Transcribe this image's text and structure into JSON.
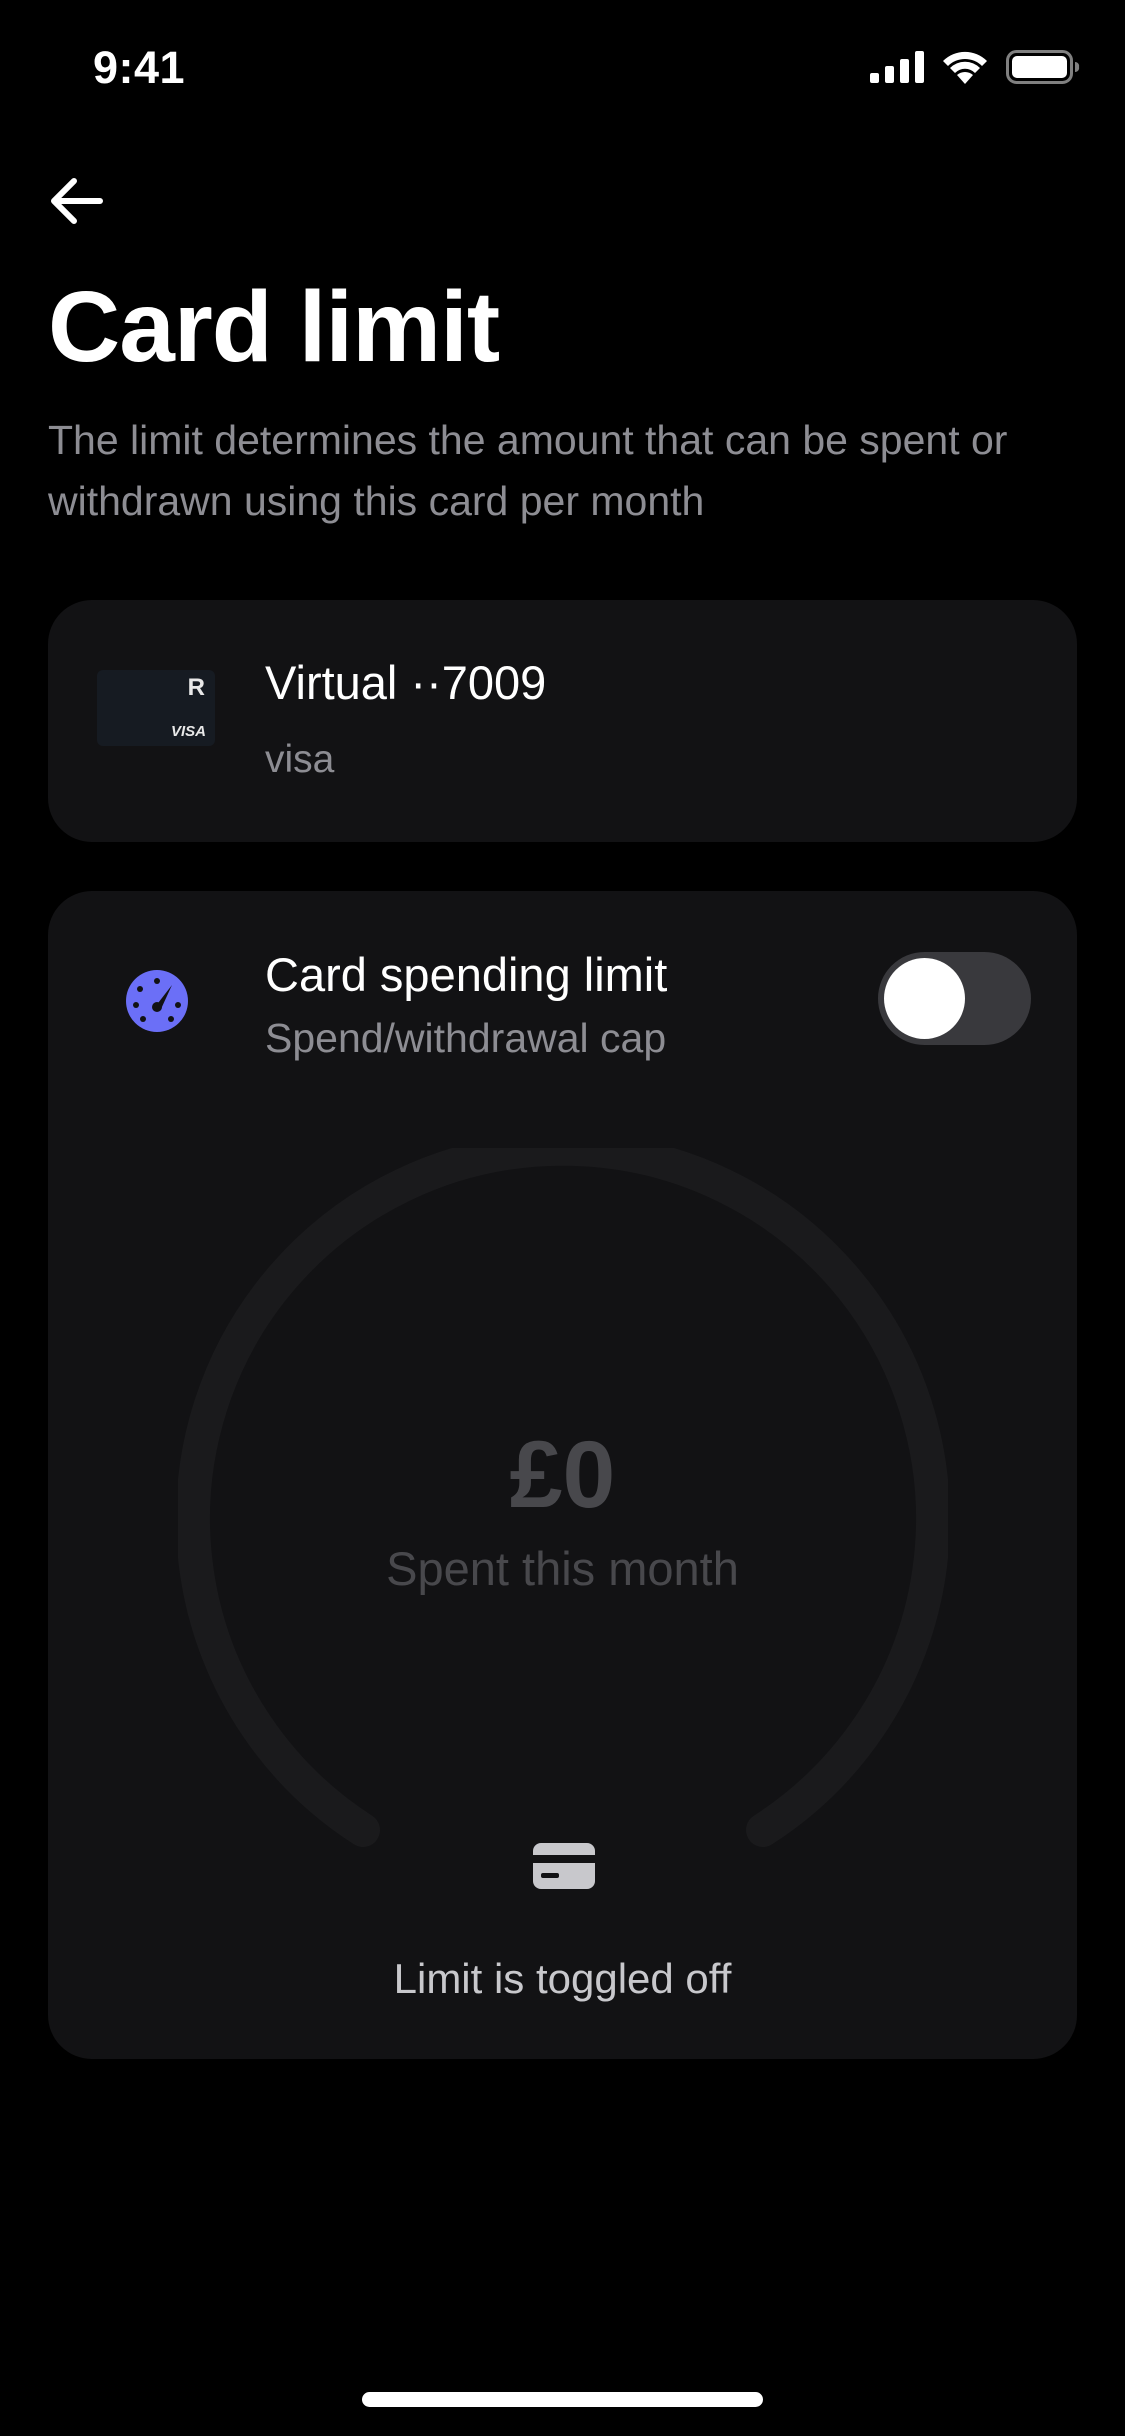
{
  "status_bar": {
    "time": "9:41"
  },
  "header": {
    "title": "Card limit",
    "description": "The limit determines the amount that can be spent or withdrawn using this card per month"
  },
  "card": {
    "name": "Virtual ··7009",
    "type": "visa",
    "thumb_brand": "R",
    "thumb_network": "VISA"
  },
  "limit": {
    "title": "Card spending limit",
    "subtitle": "Spend/withdrawal cap",
    "toggle_on": false,
    "spent_amount": "£0",
    "spent_label": "Spent this month",
    "status_text": "Limit is toggled off",
    "icon": "speedometer-icon"
  },
  "colors": {
    "background": "#000000",
    "panel": "#121214",
    "accent": "#6b6ff7",
    "muted_text": "#8d8d93",
    "toggle_track": "#39393d"
  }
}
